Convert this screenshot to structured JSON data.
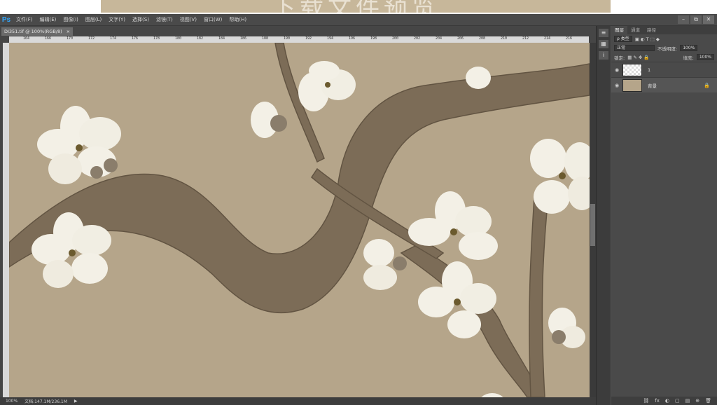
{
  "banner": {
    "text": "下载文件预览"
  },
  "menubar": {
    "logo": "Ps",
    "items": [
      "文件(F)",
      "编辑(E)",
      "图像(I)",
      "图层(L)",
      "文字(Y)",
      "选择(S)",
      "滤镜(T)",
      "视图(V)",
      "窗口(W)",
      "帮助(H)"
    ],
    "window_controls": [
      "–",
      "⧉",
      "✕"
    ]
  },
  "document": {
    "tab_title": "DI351.tif @ 100%(RGB/8)",
    "tab_close": "×",
    "ruler_ticks": [
      "164",
      "166",
      "170",
      "172",
      "174",
      "176",
      "178",
      "180",
      "182",
      "184",
      "186",
      "188",
      "190",
      "192",
      "194",
      "196",
      "198",
      "200",
      "202",
      "204",
      "206",
      "208",
      "210",
      "212",
      "214",
      "216"
    ]
  },
  "statusbar": {
    "zoom": "100%",
    "doc_info": "文档:147.1M/236.1M",
    "arrow": "▶"
  },
  "layers_panel": {
    "tabs": [
      "图层",
      "通道",
      "路径"
    ],
    "filter_label": "ρ 类型",
    "blend_mode": "正常",
    "opacity_label": "不透明度:",
    "opacity_value": "100%",
    "lock_label": "锁定:",
    "fill_label": "填充:",
    "fill_value": "100%",
    "layers": [
      {
        "name": "1"
      },
      {
        "name": "背景",
        "locked": true
      }
    ],
    "bottom_icons": [
      "fx",
      "◐",
      "▢",
      "▤",
      "⊕",
      "🗑"
    ]
  },
  "colors": {
    "canvas_bg": "#b5a58a",
    "branch": "#7a6a55",
    "petal": "#f3f0e6",
    "stamen": "#6b5a2e",
    "accent": "#31a8ff"
  }
}
